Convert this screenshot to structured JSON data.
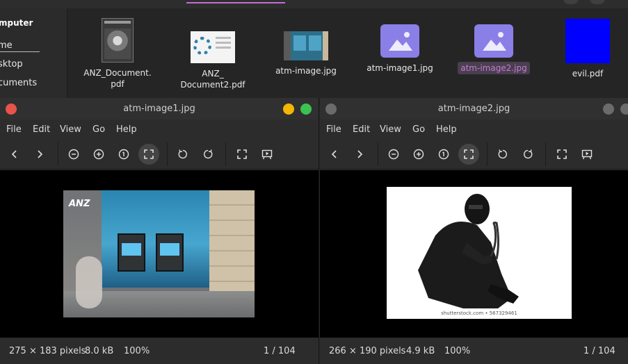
{
  "file_manager": {
    "sidebar": {
      "header": "mputer",
      "items": [
        "me",
        "sktop",
        "cuments"
      ]
    },
    "files": [
      {
        "label_line1": "ANZ_Document.",
        "label_line2": "pdf",
        "icon": "pdf-document-thumbnail-icon"
      },
      {
        "label_line1": "ANZ_",
        "label_line2": "Document2.pdf",
        "icon": "pdf-document-thumbnail-icon"
      },
      {
        "label_line1": "atm-image.jpg",
        "label_line2": "",
        "icon": "image-thumbnail-icon"
      },
      {
        "label_line1": "atm-image1.jpg",
        "label_line2": "",
        "icon": "image-placeholder-icon"
      },
      {
        "label_line1": "atm-image2.jpg",
        "label_line2": "",
        "icon": "image-placeholder-icon",
        "selected": true
      },
      {
        "label_line1": "evil.pdf",
        "label_line2": "",
        "icon": "blue-thumbnail-icon"
      }
    ],
    "accent_color": "#c36ed6"
  },
  "viewers": {
    "left": {
      "title": "atm-image1.jpg",
      "menu": [
        "File",
        "Edit",
        "View",
        "Go",
        "Help"
      ],
      "toolbar_icons": [
        "back-icon",
        "forward-icon",
        "zoom-out-icon",
        "zoom-in-icon",
        "zoom-1-1-icon",
        "best-fit-icon",
        "rotate-left-icon",
        "rotate-right-icon",
        "fullscreen-icon",
        "slideshow-icon"
      ],
      "status": {
        "dimensions": "275 × 183 pixels",
        "size": "8.0 kB",
        "zoom": "100%",
        "position": "1 / 104"
      },
      "image_text": "ANZ"
    },
    "right": {
      "title": "atm-image2.jpg",
      "menu": [
        "File",
        "Edit",
        "View",
        "Go",
        "Help"
      ],
      "toolbar_icons": [
        "back-icon",
        "forward-icon",
        "zoom-out-icon",
        "zoom-in-icon",
        "zoom-1-1-icon",
        "best-fit-icon",
        "rotate-left-icon",
        "rotate-right-icon",
        "fullscreen-icon",
        "slideshow-icon"
      ],
      "status": {
        "dimensions": "266 × 190 pixels",
        "size": "4.9 kB",
        "zoom": "100%",
        "position": "1 / 104"
      },
      "image_caption": "shutterstock.com • 567329461"
    }
  },
  "colors": {
    "close": "#e8534a",
    "minimize": "#f2b705",
    "maximize": "#3cc24f",
    "inactive_btn": "#6b6b6b"
  }
}
